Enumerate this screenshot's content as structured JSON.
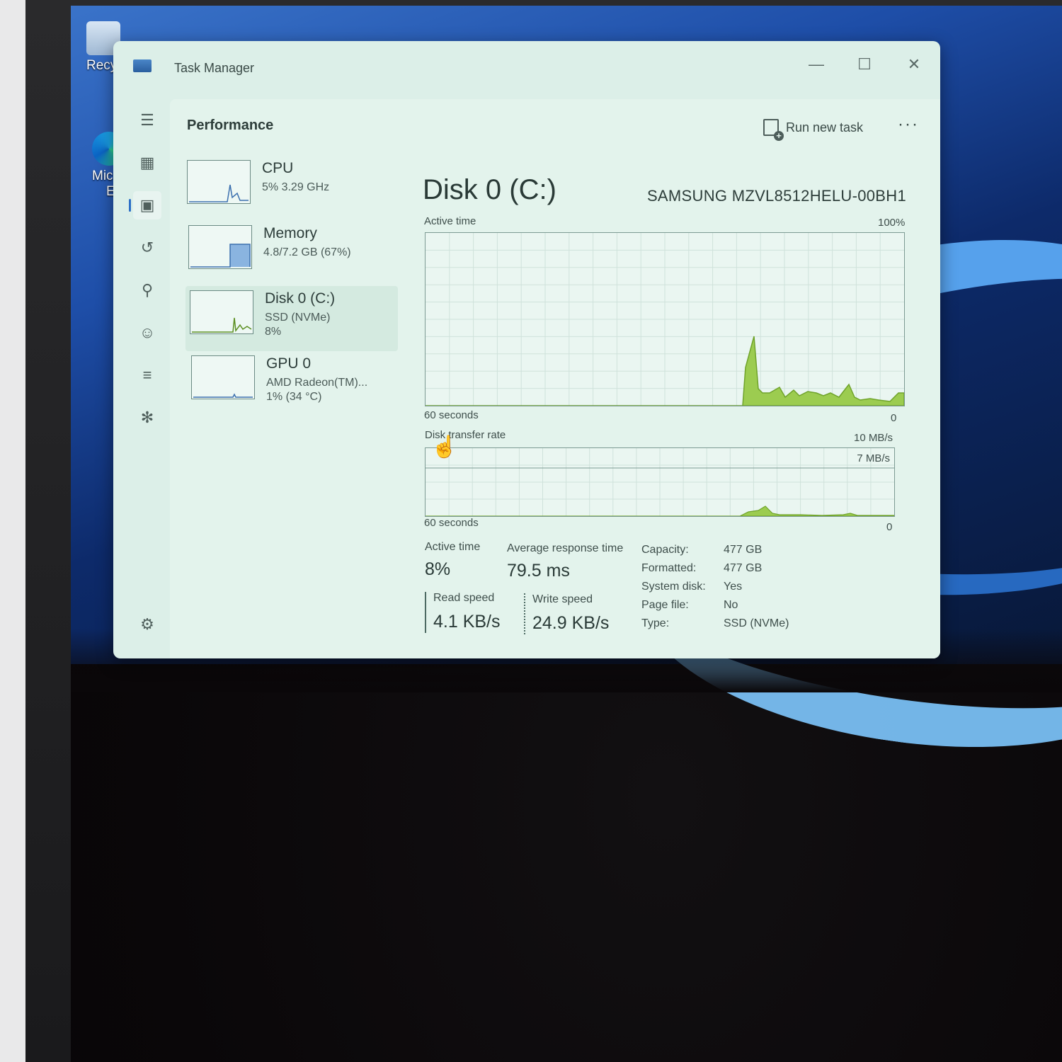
{
  "desktop": {
    "icons": [
      {
        "label": "Recy"
      },
      {
        "label": "Mic",
        "label2": "Ed"
      }
    ]
  },
  "window": {
    "title": "Task Manager",
    "controls": {
      "minimize": "—",
      "maximize": "☐",
      "close": "✕"
    }
  },
  "nav_rail": [
    {
      "icon": "hamburger-menu-icon",
      "glyph": "☰"
    },
    {
      "icon": "processes-icon",
      "glyph": "▦"
    },
    {
      "icon": "performance-icon",
      "glyph": "▣",
      "active": true
    },
    {
      "icon": "app-history-icon",
      "glyph": "↺"
    },
    {
      "icon": "startup-apps-icon",
      "glyph": "⚲"
    },
    {
      "icon": "users-icon",
      "glyph": "☺"
    },
    {
      "icon": "details-icon",
      "glyph": "≡"
    },
    {
      "icon": "services-icon",
      "glyph": "✻"
    },
    {
      "icon": "settings-icon",
      "glyph": "⚙"
    }
  ],
  "header": {
    "page_title": "Performance",
    "run_new_task": "Run new task",
    "more": "···"
  },
  "devices": [
    {
      "name": "CPU",
      "sub": "5% 3.29 GHz",
      "sub2": "",
      "selected": false
    },
    {
      "name": "Memory",
      "sub": "4.8/7.2 GB (67%)",
      "sub2": "",
      "selected": false
    },
    {
      "name": "Disk 0 (C:)",
      "sub": "SSD (NVMe)",
      "sub2": "8%",
      "selected": true
    },
    {
      "name": "GPU 0",
      "sub": "AMD Radeon(TM)...",
      "sub2": "1% (34 °C)",
      "selected": false
    }
  ],
  "detail": {
    "title": "Disk 0 (C:)",
    "model": "SAMSUNG MZVL8512HELU-00BH1",
    "active_graph": {
      "label": "Active time",
      "max": "100%",
      "span": "60 seconds",
      "min": "0"
    },
    "transfer_graph": {
      "label": "Disk transfer rate",
      "max": "10 MB/s",
      "line_label": "7 MB/s",
      "span": "60 seconds",
      "min": "0"
    },
    "stats": {
      "active_time_label": "Active time",
      "active_time_value": "8%",
      "avg_response_label": "Average response time",
      "avg_response_value": "79.5 ms",
      "read_label": "Read speed",
      "read_value": "4.1 KB/s",
      "write_label": "Write speed",
      "write_value": "24.9 KB/s"
    },
    "properties": [
      {
        "key": "Capacity:",
        "value": "477 GB"
      },
      {
        "key": "Formatted:",
        "value": "477 GB"
      },
      {
        "key": "System disk:",
        "value": "Yes"
      },
      {
        "key": "Page file:",
        "value": "No"
      },
      {
        "key": "Type:",
        "value": "SSD (NVMe)"
      }
    ]
  },
  "colors": {
    "graph_fill": "#9ccc50",
    "graph_line": "#6fa32a",
    "accent": "#2d6fc7"
  }
}
